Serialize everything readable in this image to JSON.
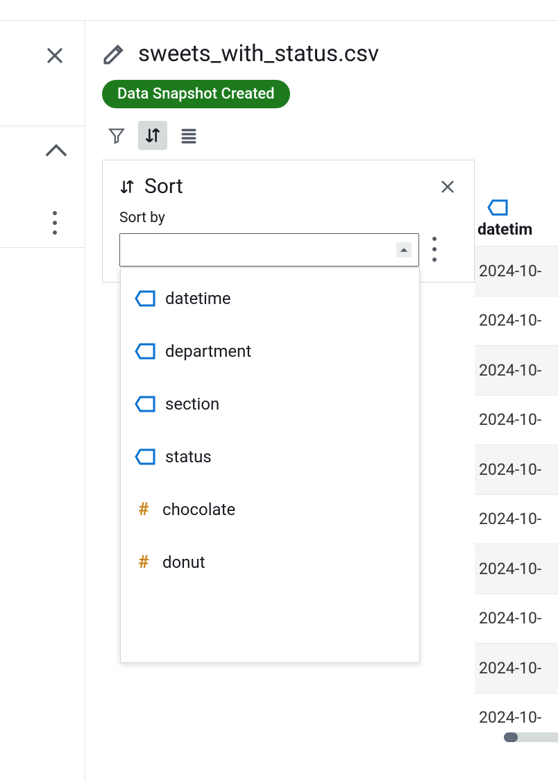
{
  "header": {
    "filename": "sweets_with_status.csv"
  },
  "badge": {
    "label": "Data Snapshot Created"
  },
  "sort_panel": {
    "title": "Sort",
    "sortby_label": "Sort by",
    "input_value": ""
  },
  "dropdown_options": [
    {
      "label": "datetime",
      "type": "tag"
    },
    {
      "label": "department",
      "type": "tag"
    },
    {
      "label": "section",
      "type": "tag"
    },
    {
      "label": "status",
      "type": "tag"
    },
    {
      "label": "chocolate",
      "type": "hash"
    },
    {
      "label": "donut",
      "type": "hash"
    }
  ],
  "table": {
    "column_header": "datetim",
    "rows": [
      "2024-10-",
      "2024-10-",
      "2024-10-",
      "2024-10-",
      "2024-10-",
      "2024-10-",
      "2024-10-",
      "2024-10-",
      "2024-10-",
      "2024-10-"
    ]
  }
}
